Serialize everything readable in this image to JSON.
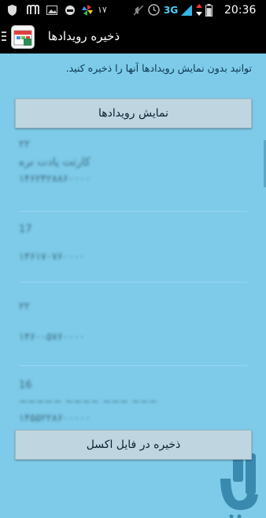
{
  "status_bar": {
    "network": "3G",
    "battery_level": 0.85,
    "time": "20:36",
    "notification_count": "۱۷",
    "icons": [
      "shield-icon",
      "m-logo-icon",
      "image-icon",
      "helmet-icon",
      "pinwheel-icon",
      "notification-count",
      "mute-icon",
      "clock-icon",
      "3g-icon",
      "signal-icon",
      "data-icon",
      "battery-icon"
    ]
  },
  "app_bar": {
    "title": "ذخیره رویدادها",
    "menu_icon": "menu-icon",
    "app_icon": "calendar-app-icon"
  },
  "intro": {
    "text": "توانید بدون نمایش رویدادها آنها را ذخیره کنید."
  },
  "buttons": {
    "show_events": "نمایش رویدادها",
    "save_excel": "ذخیره در فایل اکسل"
  },
  "events": [
    {
      "lines": [
        "۲۲",
        "کارتت پادت نره",
        "۱۴۶۲۴۲۸۸۶۰۰۰۰"
      ]
    },
    {
      "lines": [
        "17",
        "۱۴۶۱۷۰۷۶۰۰۰۰"
      ]
    },
    {
      "lines": [
        "۲۲",
        "۱۴۶۰۰۵۷۶۰۰۰۰"
      ]
    },
    {
      "lines": [
        "16",
        "~~~~~ ~~~~ ~~~ ~~~",
        "۱۴۵۵۲۲۸۶۰۰۰۰۰"
      ]
    }
  ],
  "colors": {
    "background": "#7dcbe9",
    "button": "#bfd5df",
    "bar": "#000000",
    "watermark": "#2f7fa6"
  }
}
